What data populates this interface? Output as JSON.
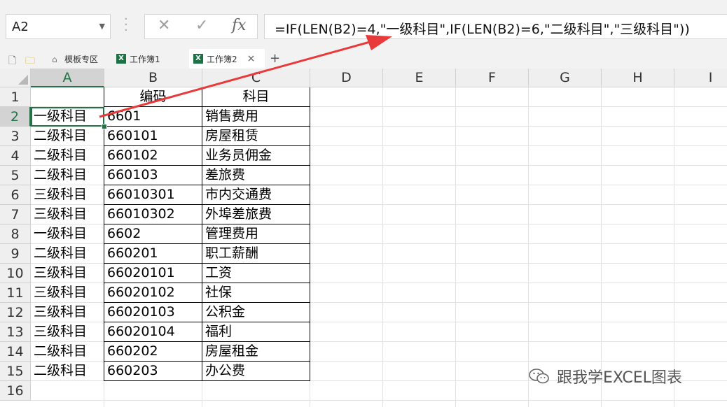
{
  "formula_bar": {
    "name_box": "A2",
    "cancel_glyph": "✕",
    "confirm_glyph": "✓",
    "fx_glyph": "fx",
    "formula": "=IF(LEN(B2)=4,\"一级科目\",IF(LEN(B2)=6,\"二级科目\",\"三级科目\"))"
  },
  "tabs": {
    "template_tab": "模板专区",
    "workbook1": "工作簿1",
    "workbook2": "工作簿2",
    "close_glyph": "×",
    "add_glyph": "+",
    "xls_glyph": "X"
  },
  "sheet": {
    "columns": [
      "A",
      "B",
      "C",
      "D",
      "E",
      "F",
      "G",
      "H",
      "I"
    ],
    "rows": [
      "1",
      "2",
      "3",
      "4",
      "5",
      "6",
      "7",
      "8",
      "9",
      "10",
      "11",
      "12",
      "13",
      "14",
      "15",
      "16"
    ],
    "header_row": {
      "a": "",
      "b": "编码",
      "c": "科目"
    },
    "data": [
      {
        "level": "一级科目",
        "code": "6601",
        "subject": "销售费用"
      },
      {
        "level": "二级科目",
        "code": "660101",
        "subject": "房屋租赁"
      },
      {
        "level": "二级科目",
        "code": "660102",
        "subject": "业务员佣金"
      },
      {
        "level": "二级科目",
        "code": "660103",
        "subject": "差旅费"
      },
      {
        "level": "三级科目",
        "code": "66010301",
        "subject": "市内交通费"
      },
      {
        "level": "三级科目",
        "code": "66010302",
        "subject": "外埠差旅费"
      },
      {
        "level": "一级科目",
        "code": "6602",
        "subject": "管理费用"
      },
      {
        "level": "二级科目",
        "code": "660201",
        "subject": "职工薪酬"
      },
      {
        "level": "三级科目",
        "code": "66020101",
        "subject": "工资"
      },
      {
        "level": "三级科目",
        "code": "66020102",
        "subject": "社保"
      },
      {
        "level": "三级科目",
        "code": "66020103",
        "subject": "公积金"
      },
      {
        "level": "三级科目",
        "code": "66020104",
        "subject": "福利"
      },
      {
        "level": "二级科目",
        "code": "660202",
        "subject": "房屋租金"
      },
      {
        "level": "二级科目",
        "code": "660203",
        "subject": "办公费"
      }
    ]
  },
  "watermark": {
    "text": "跟我学EXCEL图表"
  },
  "colors": {
    "accent": "#217346",
    "annotation_arrow": "#e8393b"
  }
}
